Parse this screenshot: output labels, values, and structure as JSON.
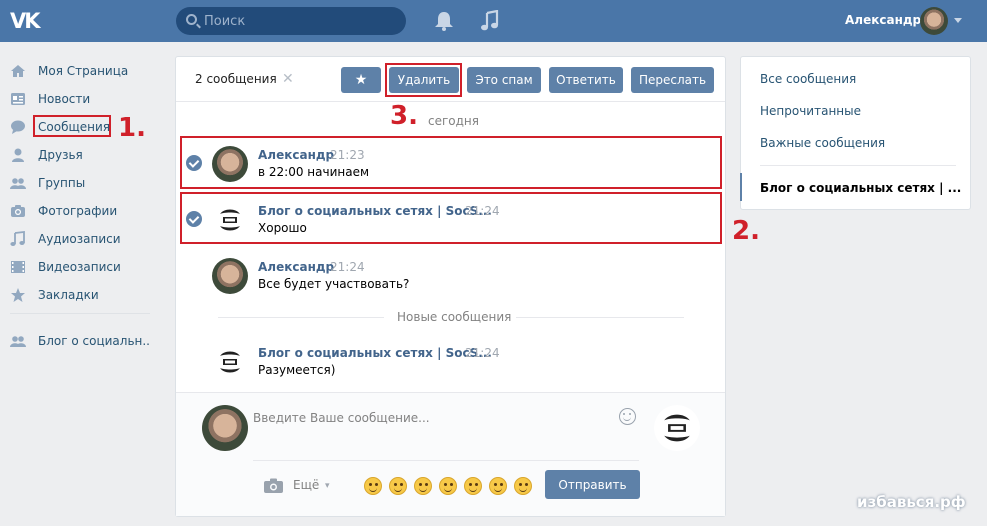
{
  "header": {
    "logo": "VK",
    "search_placeholder": "Поиск",
    "user_name": "Александр"
  },
  "sidebar": {
    "items": [
      {
        "label": "Моя Страница",
        "icon": "home-icon"
      },
      {
        "label": "Новости",
        "icon": "news-icon"
      },
      {
        "label": "Сообщения",
        "icon": "messages-icon"
      },
      {
        "label": "Друзья",
        "icon": "friend-icon"
      },
      {
        "label": "Группы",
        "icon": "groups-icon"
      },
      {
        "label": "Фотографии",
        "icon": "camera-icon"
      },
      {
        "label": "Аудиозаписи",
        "icon": "music-icon"
      },
      {
        "label": "Видеозаписи",
        "icon": "video-icon"
      },
      {
        "label": "Закладки",
        "icon": "star-icon"
      }
    ],
    "group_label": "Блог о социальн..",
    "group_icon": "groups-icon"
  },
  "toolbar": {
    "selected_count": "2 сообщения",
    "clear_glyph": "✕",
    "star_glyph": "★",
    "delete_label": "Удалить",
    "spam_label": "Это спам",
    "reply_label": "Ответить",
    "forward_label": "Переслать"
  },
  "date_separator": "сегодня",
  "messages": [
    {
      "name": "Александр",
      "time": "21:23",
      "text": "в 22:00 начинаем",
      "selected": true
    },
    {
      "name": "Блог о социальных сетях | SocS...",
      "time": "21:24",
      "text": "Хорошо",
      "selected": true
    },
    {
      "name": "Александр",
      "time": "21:24",
      "text": "Все будет участвовать?",
      "selected": false
    },
    {
      "name": "Блог о социальных сетях | SocS...",
      "time": "21:24",
      "text": "Разумеется)",
      "selected": false
    }
  ],
  "new_messages_label": "Новые сообщения",
  "composer": {
    "placeholder": "Введите Ваше сообщение...",
    "more_label": "Ещё",
    "send_label": "Отправить"
  },
  "right_panel": {
    "items": [
      "Все сообщения",
      "Непрочитанные",
      "Важные сообщения"
    ],
    "active_item": "Блог о социальных сетях | ..."
  },
  "annotations": {
    "step1": "1.",
    "step2": "2.",
    "step3": "3."
  },
  "watermark": "избавься.рф",
  "colors": {
    "header_bg": "#4a76a8",
    "button_bg": "#5e81a8",
    "link": "#285473",
    "annotation_red": "#d0202a"
  }
}
